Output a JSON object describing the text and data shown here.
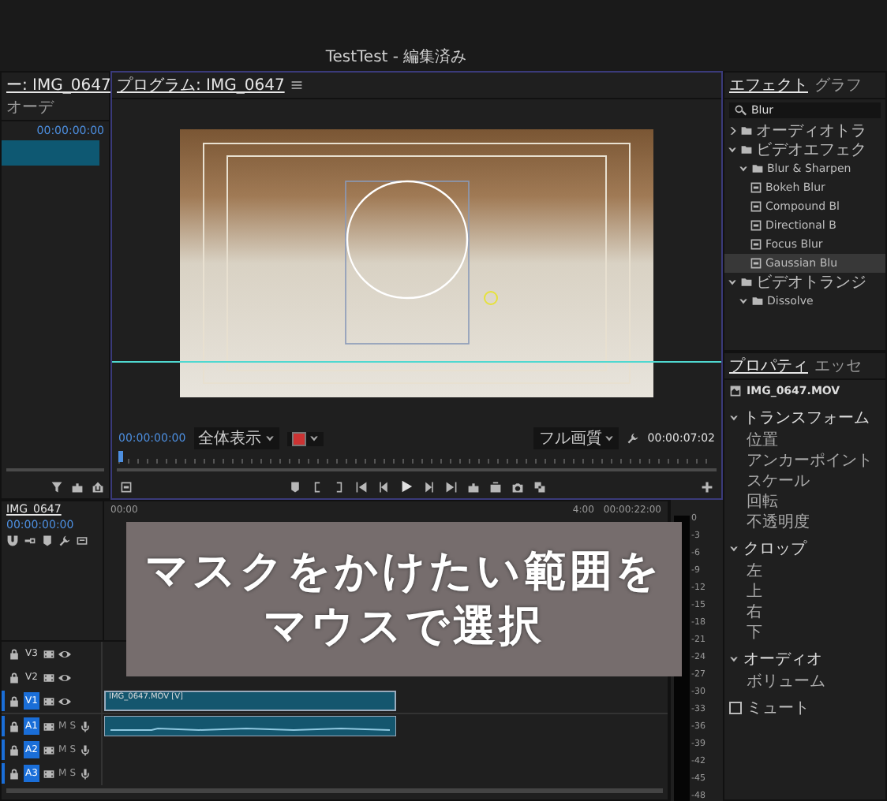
{
  "window": {
    "title": "TestTest - 編集済み"
  },
  "source_panel": {
    "tabs": [
      {
        "label": "ー: IMG_0647",
        "selected": true
      },
      {
        "label": "オーデ",
        "selected": false
      }
    ],
    "timecode": "00:00:00:00"
  },
  "program_monitor": {
    "tab": "プログラム: IMG_0647",
    "timecode": "00:00:00:00",
    "zoom": "全体表示",
    "quality": "フル画質",
    "duration": "00:00:07:02"
  },
  "effects_panel": {
    "tabs": [
      {
        "label": "エフェクト",
        "selected": true
      },
      {
        "label": "グラフ",
        "selected": false
      }
    ],
    "search": "Blur",
    "tree": [
      {
        "label": "オーディオトラ",
        "kind": "folder",
        "expanded": false,
        "selected": false
      },
      {
        "label": "ビデオエフェク",
        "kind": "folder",
        "expanded": true,
        "selected": false,
        "children": [
          {
            "label": "Blur & Sharpen",
            "kind": "folder",
            "expanded": true,
            "selected": false,
            "children": [
              {
                "label": "Bokeh Blur",
                "kind": "effect",
                "selected": false
              },
              {
                "label": "Compound Bl",
                "kind": "effect",
                "selected": false
              },
              {
                "label": "Directional B",
                "kind": "effect",
                "selected": false
              },
              {
                "label": "Focus Blur",
                "kind": "effect",
                "selected": false
              },
              {
                "label": "Gaussian Blu",
                "kind": "effect",
                "selected": true
              }
            ]
          }
        ]
      },
      {
        "label": "ビデオトランジ",
        "kind": "folder",
        "expanded": true,
        "selected": false,
        "children": [
          {
            "label": "Dissolve",
            "kind": "folder",
            "expanded": true,
            "selected": false
          }
        ]
      }
    ]
  },
  "properties_panel": {
    "tabs": [
      {
        "label": "プロパティ",
        "selected": true
      },
      {
        "label": "エッセ",
        "selected": false
      }
    ],
    "clip": "IMG_0647.MOV",
    "sections": [
      {
        "title": "トランスフォーム",
        "expanded": true,
        "items": [
          "位置",
          "アンカーポイント",
          "スケール",
          "回転",
          "不透明度"
        ]
      },
      {
        "title": "クロップ",
        "expanded": true,
        "items": [
          "左",
          "上",
          "右",
          "下"
        ]
      },
      {
        "title": "オーディオ",
        "expanded": true,
        "items": [
          "ボリューム"
        ]
      }
    ],
    "mute": {
      "label": "ミュート",
      "checked": false
    }
  },
  "timeline": {
    "tab": "IMG_0647",
    "timecode": "00:00:00:00",
    "ruler": [
      "00:00",
      "4:00",
      "00:00:22:00"
    ],
    "tracks": [
      {
        "name": "V3",
        "kind": "video",
        "targeted": false
      },
      {
        "name": "V2",
        "kind": "video",
        "targeted": false
      },
      {
        "name": "V1",
        "kind": "video",
        "targeted": true,
        "clips": [
          {
            "kind": "video",
            "label": "IMG_0647.MOV [V]"
          }
        ]
      },
      {
        "name": "A1",
        "kind": "audio",
        "targeted": true,
        "mute": "M",
        "solo": "S",
        "clips": [
          {
            "kind": "audio"
          }
        ]
      },
      {
        "name": "A2",
        "kind": "audio",
        "targeted": true,
        "mute": "M",
        "solo": "S"
      },
      {
        "name": "A3",
        "kind": "audio",
        "targeted": true,
        "mute": "M",
        "solo": "S"
      }
    ]
  },
  "audio_meter": {
    "scale": [
      "0",
      "-3",
      "-6",
      "-9",
      "-12",
      "-15",
      "-18",
      "-21",
      "-24",
      "-27",
      "-30",
      "-33",
      "-36",
      "-39",
      "-42",
      "-45",
      "-48"
    ]
  },
  "caption": {
    "lines": [
      "マスクをかけたい範囲を",
      "マウスで選択"
    ]
  }
}
